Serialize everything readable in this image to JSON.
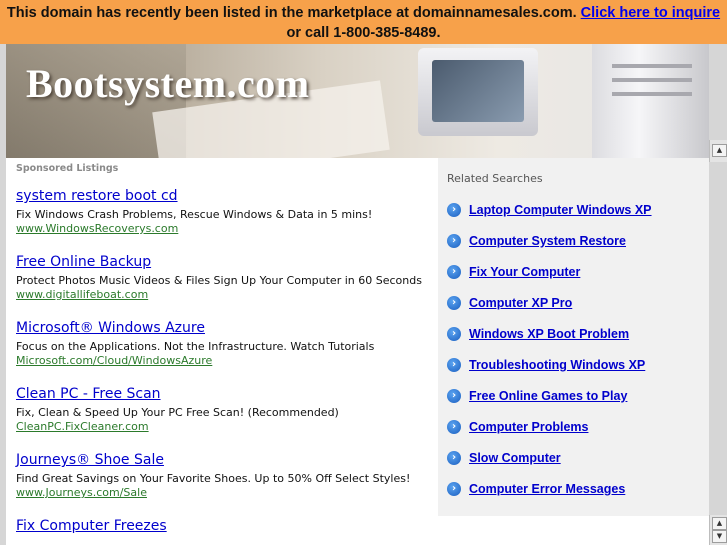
{
  "banner": {
    "text": "This domain has recently been listed in the marketplace at domainnamesales.com.",
    "link": "Click here to inquire",
    "phone": "or call 1-800-385-8489."
  },
  "header": {
    "site_title": "Bootsystem.com"
  },
  "sponsored": {
    "heading": "Sponsored Listings",
    "listings": [
      {
        "title": "system restore boot cd",
        "desc": "Fix Windows Crash Problems, Rescue Windows & Data in 5 mins!",
        "url": "www.WindowsRecoverys.com"
      },
      {
        "title": "Free Online Backup",
        "desc": "Protect Photos Music Videos & Files Sign Up Your Computer in 60 Seconds",
        "url": "www.digitallifeboat.com"
      },
      {
        "title": "Microsoft® Windows Azure",
        "desc": "Focus on the Applications. Not the Infrastructure. Watch Tutorials",
        "url": "Microsoft.com/Cloud/WindowsAzure"
      },
      {
        "title": "Clean PC - Free Scan",
        "desc": "Fix, Clean & Speed Up Your PC Free Scan! (Recommended)",
        "url": "CleanPC.FixCleaner.com"
      },
      {
        "title": "Journeys® Shoe Sale",
        "desc": "Find Great Savings on Your Favorite Shoes. Up to 50% Off Select Styles!",
        "url": "www.Journeys.com/Sale"
      },
      {
        "title": "Fix Computer Freezes",
        "desc": "",
        "url": ""
      }
    ]
  },
  "related": {
    "heading": "Related Searches",
    "items": [
      "Laptop Computer Windows XP",
      "Computer System Restore",
      "Fix Your Computer",
      "Computer XP Pro",
      "Windows XP Boot Problem",
      "Troubleshooting Windows XP",
      "Free Online Games to Play",
      "Computer Problems",
      "Slow Computer",
      "Computer Error Messages"
    ]
  },
  "colors": {
    "banner_bg": "#f7a14a",
    "link": "#0000cc",
    "url_green": "#2b7a2b",
    "related_bg": "#f1f1f1"
  },
  "icons": {
    "related_bullet": "arrow-circle-icon",
    "scroll_up": "scroll-up-arrow-icon"
  }
}
